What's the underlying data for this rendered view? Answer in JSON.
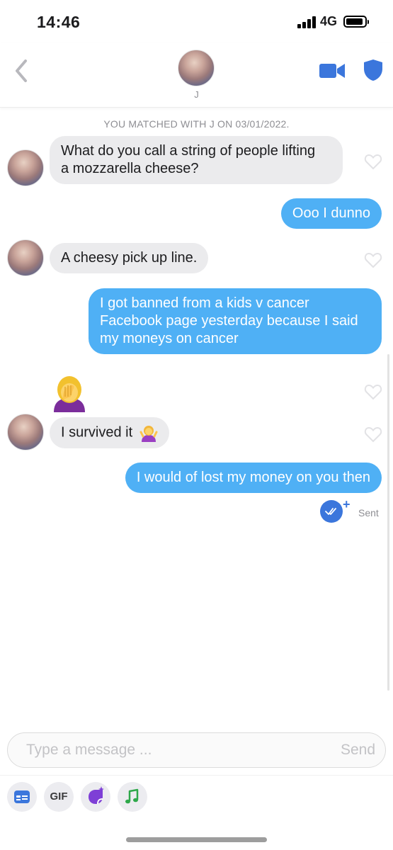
{
  "status_bar": {
    "time": "14:46",
    "network": "4G"
  },
  "header": {
    "name": "J",
    "back_icon": "chevron-left-icon",
    "video_icon": "video-camera-icon",
    "safety_icon": "shield-icon"
  },
  "match_banner": "YOU MATCHED WITH J ON 03/01/2022.",
  "messages": [
    {
      "from": "them",
      "text": "What do you call a string of people lifting a mozzarella cheese?",
      "lines": [
        "What do you call a string of people lifting",
        "a mozzarella cheese?"
      ]
    },
    {
      "from": "me",
      "text": "Ooo I dunno"
    },
    {
      "from": "them",
      "text": "A cheesy pick up line."
    },
    {
      "from": "me",
      "text": "I got banned from a kids v cancer Facebook page yesterday because I said my moneys on cancer",
      "lines": [
        "I got banned from a kids v cancer",
        "Facebook page yesterday because I said",
        "my moneys on cancer"
      ]
    },
    {
      "from": "them",
      "emoji": "woman-facepalming-emoji"
    },
    {
      "from": "them",
      "text": "I survived it",
      "emoji": "woman-shrugging-emoji"
    },
    {
      "from": "me",
      "text": "I would of lost my money on you then"
    }
  ],
  "status": {
    "sent_label": "Sent"
  },
  "composer": {
    "placeholder": "Type a message ...",
    "send_label": "Send"
  },
  "toolbar": {
    "gif_label": "GIF",
    "icons": [
      "id-card-icon",
      "gif-icon",
      "sticker-icon",
      "music-note-icon"
    ]
  },
  "colors": {
    "outgoing": "#4fb0f5",
    "incoming": "#ebebed",
    "accent": "#3b76dc"
  }
}
